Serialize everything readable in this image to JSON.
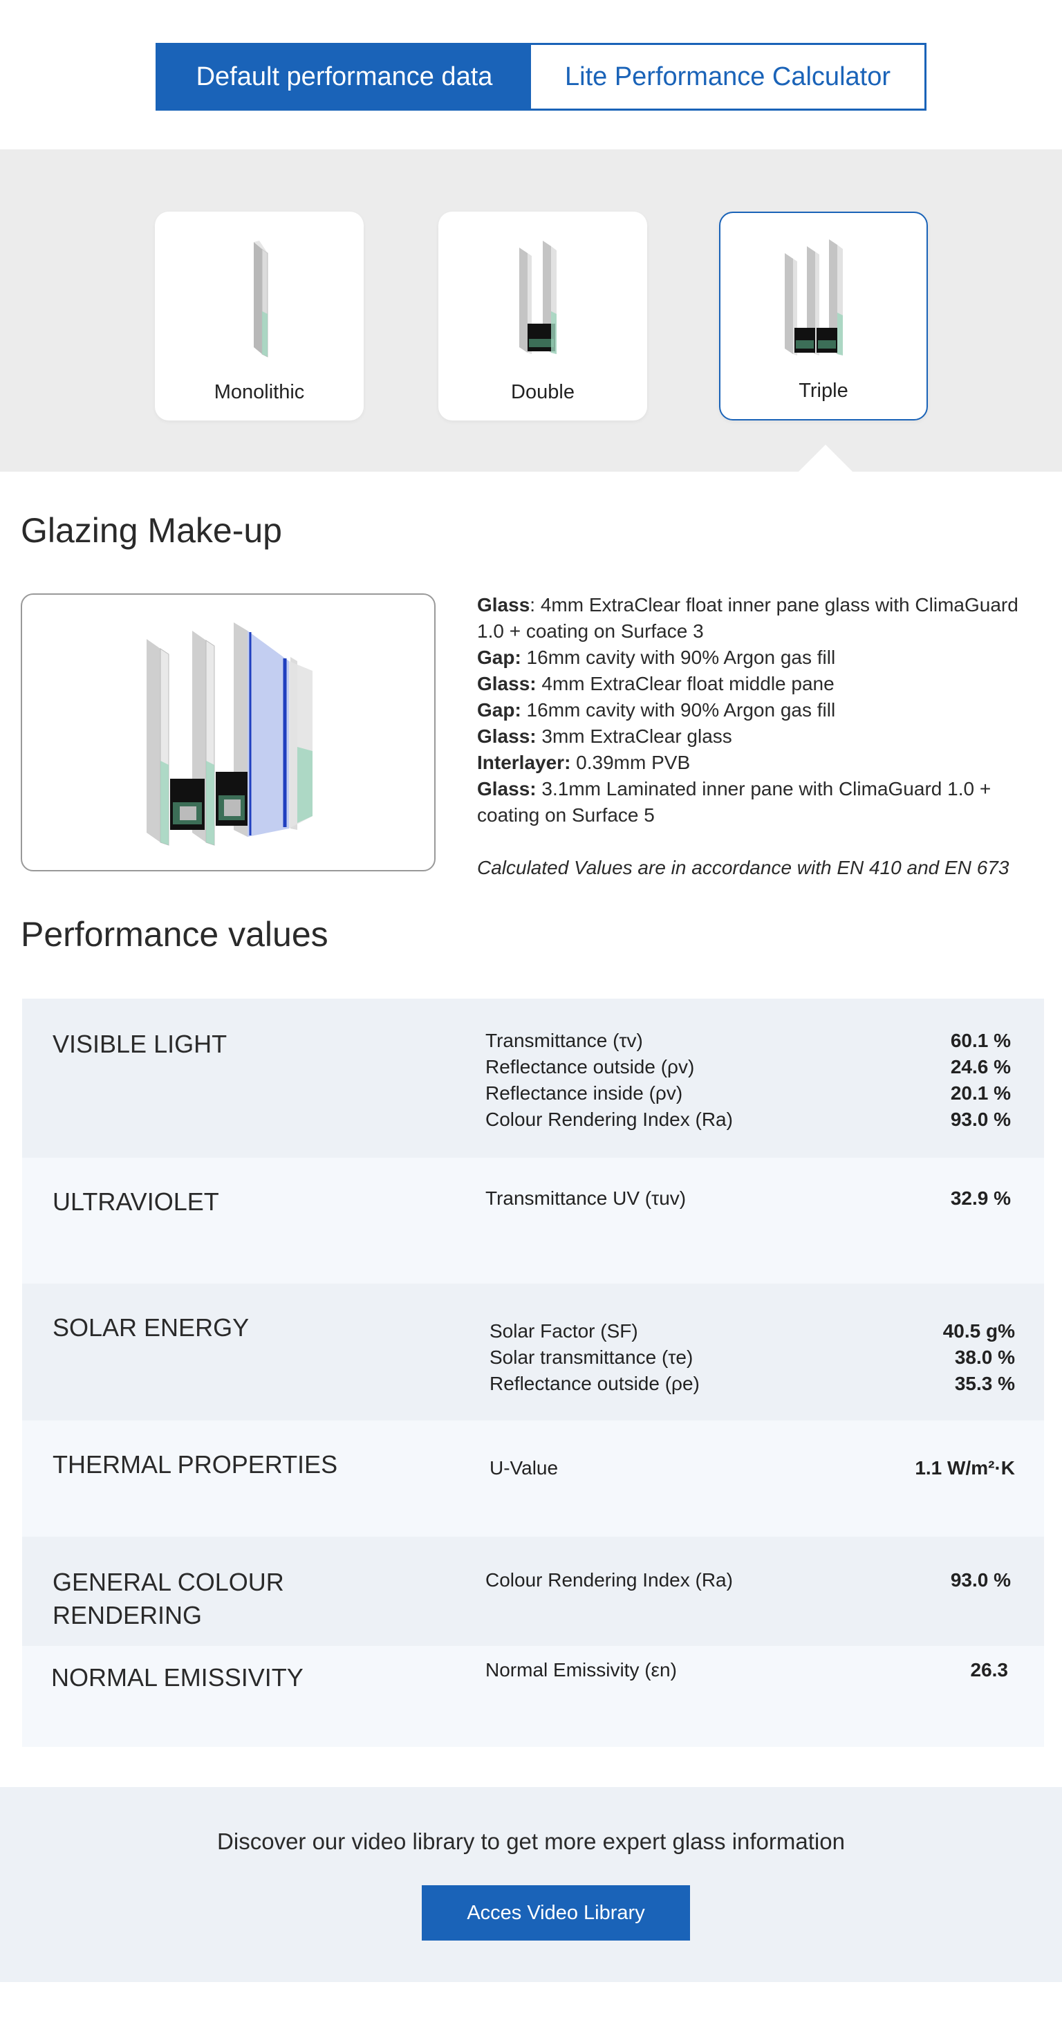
{
  "tabs": [
    {
      "label": "Default performance data",
      "active": true
    },
    {
      "label": "Lite Performance Calculator",
      "active": false
    }
  ],
  "glazing_types": [
    {
      "label": "Monolithic",
      "icon": "monolithic-glass-icon"
    },
    {
      "label": "Double",
      "icon": "double-glazing-icon"
    },
    {
      "label": "Triple",
      "icon": "triple-glazing-icon",
      "selected": true
    }
  ],
  "makeup": {
    "title": "Glazing Make-up",
    "image_icon": "triple-glazing-makeup-icon",
    "lines": [
      {
        "label": "Glass",
        "text": ": 4mm ExtraClear float inner pane glass with ClimaGuard 1.0 + coating on Surface 3"
      },
      {
        "label": "Gap:",
        "text": " 16mm cavity with 90% Argon gas fill"
      },
      {
        "label": "Glass:",
        "text": " 4mm ExtraClear float middle pane"
      },
      {
        "label": "Gap:",
        "text": " 16mm cavity with 90% Argon gas fill"
      },
      {
        "label": "Glass:",
        "text": " 3mm ExtraClear glass"
      },
      {
        "label": "Interlayer:",
        "text": " 0.39mm PVB"
      },
      {
        "label": "Glass:",
        "text": " 3.1mm Laminated inner pane with ClimaGuard 1.0 + coating on Surface 5"
      }
    ],
    "note": "Calculated Values are in accordance with EN 410 and EN 673"
  },
  "performance": {
    "title": "Performance values",
    "rows": [
      {
        "category": "VISIBLE LIGHT",
        "metrics": [
          {
            "label": "Transmittance (τv)",
            "value": "60.1 %"
          },
          {
            "label": "Reflectance outside (ρv)",
            "value": "24.6 %"
          },
          {
            "label": "Reflectance inside (ρv)",
            "value": "20.1 %"
          },
          {
            "label": "Colour Rendering Index (Ra)",
            "value": "93.0 %"
          }
        ]
      },
      {
        "category": "ULTRAVIOLET",
        "metrics": [
          {
            "label": "Transmittance UV (τuv)",
            "value": "32.9 %"
          }
        ]
      },
      {
        "category": "SOLAR ENERGY",
        "metrics": [
          {
            "label": "Solar Factor (SF)",
            "value": "40.5 g%"
          },
          {
            "label": "Solar transmittance (τe)",
            "value": "38.0 %"
          },
          {
            "label": "Reflectance outside (ρe)",
            "value": "35.3 %"
          }
        ]
      },
      {
        "category": "THERMAL PROPERTIES",
        "metrics": [
          {
            "label": "U-Value",
            "value": "1.1 W/m²·K"
          }
        ]
      },
      {
        "category": "GENERAL COLOUR RENDERING",
        "metrics": [
          {
            "label": "Colour Rendering Index (Ra)",
            "value": "93.0 %"
          }
        ]
      },
      {
        "category": "NORMAL EMISSIVITY",
        "metrics": [
          {
            "label": "Normal Emissivity (εn)",
            "value": "26.3"
          }
        ]
      }
    ]
  },
  "cta": {
    "text": "Discover our video library to get more expert glass information",
    "button": "Acces Video Library"
  },
  "colors": {
    "accent": "#1a63b8",
    "band": "#ececec",
    "row_dark": "#edf1f6",
    "row_light": "#f5f8fc"
  }
}
